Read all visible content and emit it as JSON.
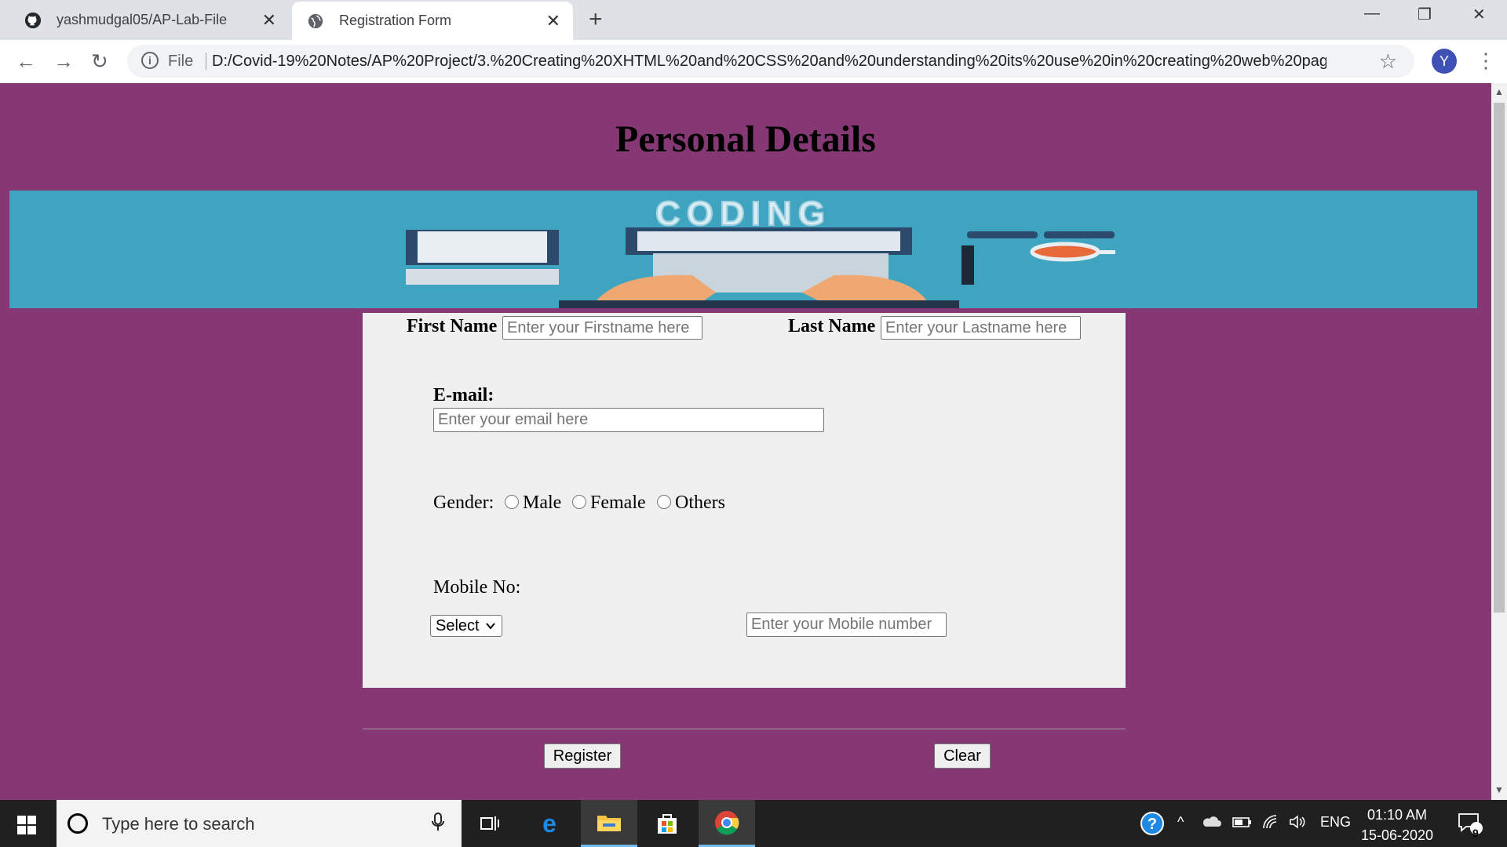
{
  "browser": {
    "tabs": [
      {
        "title": "yashmudgal05/AP-Lab-File",
        "icon": "github-icon",
        "close": "✕"
      },
      {
        "title": "Registration Form",
        "icon": "globe-icon",
        "close": "✕"
      }
    ],
    "new_tab": "+",
    "window_controls": {
      "minimize": "—",
      "restore": "❐",
      "close": "✕"
    },
    "nav": {
      "back": "←",
      "forward": "→",
      "reload": "↻"
    },
    "address": {
      "scheme_label": "File",
      "info_glyph": "i",
      "url": "D:/Covid-19%20Notes/AP%20Project/3.%20Creating%20XHTML%20and%20CSS%20and%20understanding%20its%20use%20in%20creating%20web%20pag..."
    },
    "bookmark_glyph": "☆",
    "profile_initial": "Y",
    "menu_glyph": "⋮"
  },
  "page": {
    "heading": "Personal Details",
    "banner_text": "CODING",
    "form": {
      "first_name_label": "First Name",
      "first_name_placeholder": "Enter your Firstname here",
      "last_name_label": "Last Name",
      "last_name_placeholder": "Enter your Lastname here",
      "email_label": "E-mail:",
      "email_placeholder": "Enter your email here",
      "gender_label": "Gender:",
      "gender_options": [
        "Male",
        "Female",
        "Others"
      ],
      "mobile_label": "Mobile No:",
      "country_code_selected": "Select",
      "mobile_placeholder": "Enter your Mobile number",
      "register_label": "Register",
      "clear_label": "Clear"
    }
  },
  "taskbar": {
    "search_placeholder": "Type here to search",
    "apps": [
      "task-view-icon",
      "edge-icon",
      "file-explorer-icon",
      "store-icon",
      "chrome-icon"
    ],
    "tray": {
      "language": "ENG",
      "up_arrow": "^"
    },
    "clock": {
      "time": "01:10 AM",
      "date": "15-06-2020"
    },
    "notifications_count": "9"
  },
  "colors": {
    "page_background": "#853873",
    "banner_background": "#3ea4c0",
    "form_background": "#f0f0f0"
  }
}
